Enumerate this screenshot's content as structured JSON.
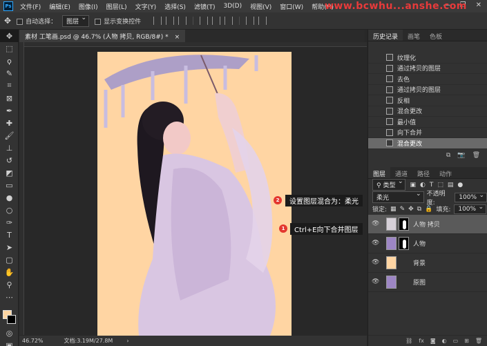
{
  "menubar": {
    "logo": "Ps",
    "items": [
      "文件(F)",
      "编辑(E)",
      "图像(I)",
      "图层(L)",
      "文字(Y)",
      "选择(S)",
      "滤镜(T)",
      "3D(D)",
      "视图(V)",
      "窗口(W)",
      "帮助(H)"
    ],
    "watermark": "www.bcwhu...anshe.com",
    "win_minimize": "—",
    "win_restore": "❐",
    "win_close": "✕"
  },
  "options": {
    "auto_select_label": "自动选择：",
    "auto_select_value": "图层",
    "show_transform_label": "显示变换控件"
  },
  "document": {
    "tab_title": "素材 工笔画.psd @ 46.7% (人物 拷贝, RGB/8#) *",
    "tab_close": "×"
  },
  "annotations": [
    {
      "num": "2",
      "text": "设置图层混合为：柔光"
    },
    {
      "num": "1",
      "text": "Ctrl+E向下合并图层"
    }
  ],
  "status": {
    "zoom": "46.72%",
    "doc_info": "文档:3.19M/27.8M",
    "arrow": "›"
  },
  "history_panel": {
    "tabs": [
      "历史记录",
      "画笔",
      "色板"
    ],
    "items": [
      "纹理化",
      "通过拷贝的图层",
      "去色",
      "通过拷贝的图层",
      "反相",
      "混合更改",
      "最小值",
      "向下合并",
      "混合更改"
    ],
    "selected_index": 8
  },
  "layers_panel": {
    "tabs": [
      "图层",
      "通道",
      "路径",
      "动作"
    ],
    "filter_kind": "类型",
    "blend_mode": "柔光",
    "opacity_label": "不透明度:",
    "opacity_value": "100%",
    "lock_label": "锁定:",
    "fill_label": "填充:",
    "fill_value": "100%",
    "layers": [
      {
        "name": "人物 拷贝",
        "selected": true,
        "has_mask": true,
        "thumb": "gray-figure"
      },
      {
        "name": "人物",
        "selected": false,
        "has_mask": true,
        "thumb": "purple-figure"
      },
      {
        "name": "背景",
        "selected": false,
        "has_mask": false,
        "thumb": "peach"
      },
      {
        "name": "原图",
        "selected": false,
        "has_mask": false,
        "thumb": "purple-figure"
      }
    ]
  },
  "colors": {
    "foreground": "#fdd5a2",
    "background": "#000000",
    "canvas_bg": "#ffd5a3",
    "badge": "#e3372f"
  }
}
